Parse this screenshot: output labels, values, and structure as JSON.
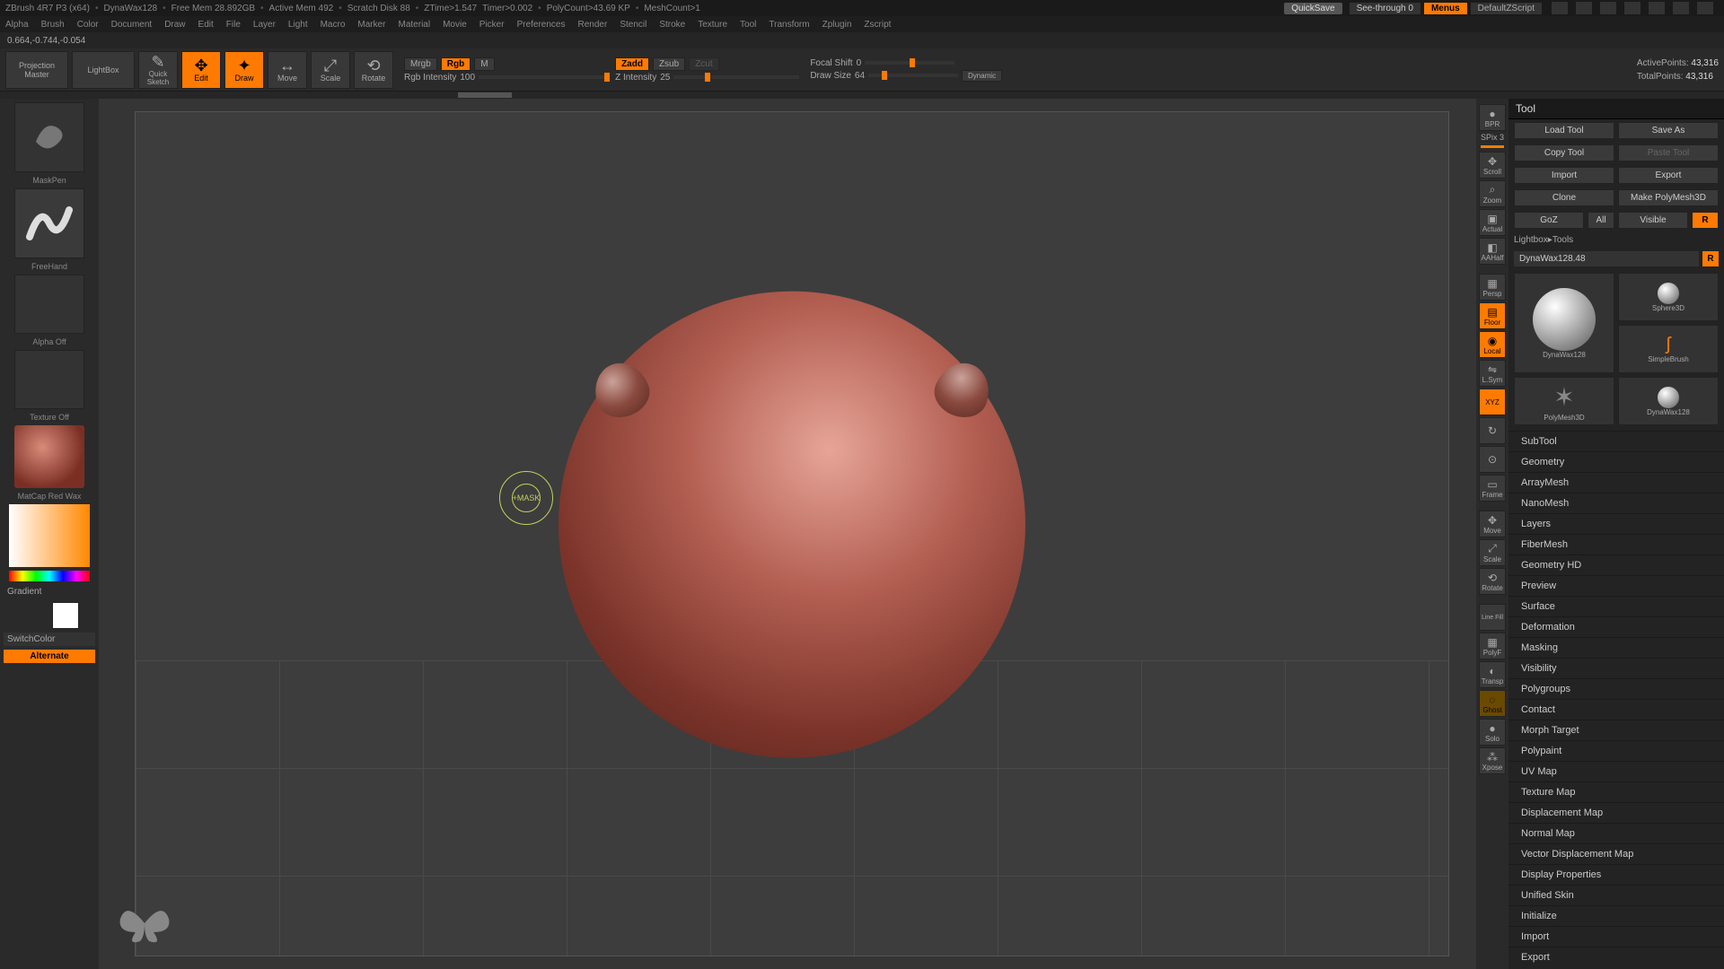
{
  "title_bar": {
    "app": "ZBrush 4R7 P3 (x64)",
    "doc": "DynaWax128",
    "free_mem": "Free Mem 28.892GB",
    "active_mem": "Active Mem 492",
    "scratch": "Scratch Disk 88",
    "ztime": "ZTime>1.547",
    "timer": "Timer>0.002",
    "polycount": "PolyCount>43.69 KP",
    "meshcount": "MeshCount>1",
    "quicksave": "QuickSave",
    "see_through": "See-through 0",
    "menus": "Menus",
    "script": "DefaultZScript"
  },
  "menu": [
    "Alpha",
    "Brush",
    "Color",
    "Document",
    "Draw",
    "Edit",
    "File",
    "Layer",
    "Light",
    "Macro",
    "Marker",
    "Material",
    "Movie",
    "Picker",
    "Preferences",
    "Render",
    "Stencil",
    "Stroke",
    "Texture",
    "Tool",
    "Transform",
    "Zplugin",
    "Zscript"
  ],
  "coords": "0.664,-0.744,-0.054",
  "toolbar": {
    "projection": "Projection\nMaster",
    "lightbox": "LightBox",
    "quicksketch": "Quick\nSketch",
    "edit": "Edit",
    "draw": "Draw",
    "move": "Move",
    "scale": "Scale",
    "rotate": "Rotate",
    "mrgb": "Mrgb",
    "rgb": "Rgb",
    "m": "M",
    "rgb_intensity_label": "Rgb Intensity",
    "rgb_intensity_val": "100",
    "zadd": "Zadd",
    "zsub": "Zsub",
    "zcut": "Zcut",
    "z_intensity_label": "Z Intensity",
    "z_intensity_val": "25",
    "focal_label": "Focal Shift",
    "focal_val": "0",
    "draw_size_label": "Draw Size",
    "draw_size_val": "64",
    "dynamic": "Dynamic",
    "active_points_label": "ActivePoints:",
    "active_points_val": "43,316",
    "total_points_label": "TotalPoints:",
    "total_points_val": "43,316"
  },
  "left": {
    "brush": "MaskPen",
    "stroke": "FreeHand",
    "alpha": "Alpha Off",
    "texture": "Texture Off",
    "material": "MatCap Red Wax",
    "gradient": "Gradient",
    "switchcolor": "SwitchColor",
    "alternate": "Alternate"
  },
  "cursor_label": "+MASK",
  "right_dock": {
    "spix_label": "SPix",
    "spix_val": "3",
    "items": [
      "BPR",
      "Scroll",
      "Zoom",
      "Actual",
      "AAHalf",
      "Persp",
      "Floor",
      "Local",
      "L.Sym",
      "XYZ",
      "↻",
      "⊙",
      "Frame",
      "Move",
      "Scale",
      "Rotate",
      "Line Fill",
      "PolyF",
      "Transp",
      "Ghost",
      "Solo",
      "Xpose"
    ],
    "active": [
      "Floor",
      "Local",
      "XYZ"
    ]
  },
  "tool_panel": {
    "title": "Tool",
    "rows": [
      [
        "Load Tool",
        "Save As"
      ],
      [
        "Copy Tool",
        "Paste Tool"
      ],
      [
        "Import",
        "Export"
      ],
      [
        "Clone",
        "Make PolyMesh3D"
      ],
      [
        "GoZ",
        "All",
        "Visible",
        "R"
      ]
    ],
    "lightbox_tools": "Lightbox▸Tools",
    "current_tool": "DynaWax128.48",
    "thumbs": [
      "DynaWax128",
      "Sphere3D",
      "SimpleBrush",
      "PolyMesh3D",
      "DynaWax128"
    ],
    "accordion": [
      "SubTool",
      "Geometry",
      "ArrayMesh",
      "NanoMesh",
      "Layers",
      "FiberMesh",
      "Geometry HD",
      "Preview",
      "Surface",
      "Deformation",
      "Masking",
      "Visibility",
      "Polygroups",
      "Contact",
      "Morph Target",
      "Polypaint",
      "UV Map",
      "Texture Map",
      "Displacement Map",
      "Normal Map",
      "Vector Displacement Map",
      "Display Properties",
      "Unified Skin",
      "Initialize",
      "Import",
      "Export"
    ]
  }
}
